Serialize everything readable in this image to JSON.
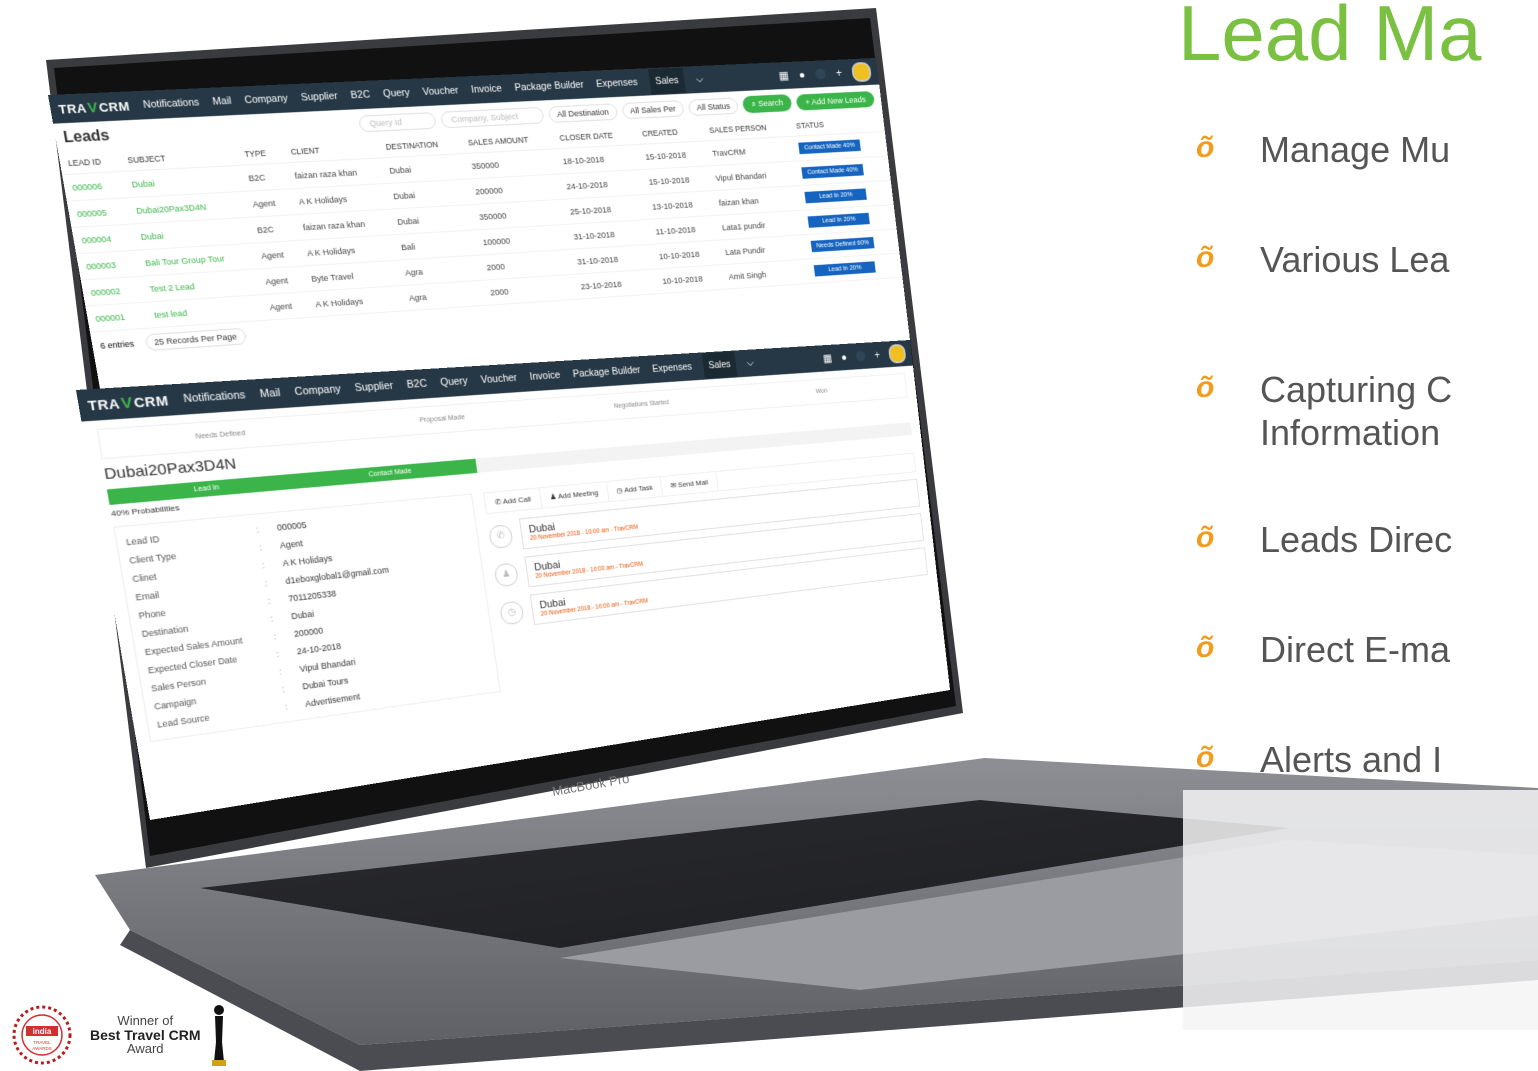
{
  "slide": {
    "title": "Lead Ma",
    "bullet_glyph": "õ",
    "bullets": [
      "Manage Mu",
      "Various Lea",
      "Capturing C",
      "Information",
      "Leads Direc",
      "Direct E-ma",
      "Alerts and I"
    ]
  },
  "award": {
    "line1": "Winner of",
    "line2": "Best Travel CRM",
    "line3": "Award",
    "seal_text": "india travel awards"
  },
  "laptop": {
    "brand_label": "MacBook Pro"
  },
  "app": {
    "logo_prefix": "TRA",
    "logo_v": "V",
    "logo_suffix": "CRM",
    "nav": [
      "Notifications",
      "Mail",
      "Company",
      "Supplier",
      "B2C",
      "Query",
      "Voucher",
      "Invoice",
      "Package Builder",
      "Expenses",
      "Sales"
    ],
    "nav_icons": [
      "calendar-icon",
      "mic-icon",
      "notification-badge",
      "plus-icon",
      "user-avatar"
    ]
  },
  "leads_page": {
    "title": "Leads",
    "filters": {
      "query_placeholder": "Query Id",
      "company_placeholder": "Company, Subject",
      "destination": "All Destination",
      "sales_person": "All Sales Per",
      "status": "All Status",
      "search": "Search",
      "add_new": "+ Add New Leads"
    },
    "columns": [
      "LEAD ID",
      "SUBJECT",
      "TYPE",
      "CLIENT",
      "DESTINATION",
      "SALES AMOUNT",
      "CLOSER DATE",
      "CREATED",
      "SALES PERSON",
      "STATUS"
    ],
    "rows": [
      [
        "000006",
        "Dubai",
        "B2C",
        "faizan raza khan",
        "Dubai",
        "350000",
        "18-10-2018",
        "15-10-2018",
        "TravCRM",
        "Contact Made 40%"
      ],
      [
        "000005",
        "Dubai20Pax3D4N",
        "Agent",
        "A K Holidays",
        "Dubai",
        "200000",
        "24-10-2018",
        "15-10-2018",
        "Vipul Bhandari",
        "Contact Made 40%"
      ],
      [
        "000004",
        "Dubai",
        "B2C",
        "faizan raza khan",
        "Dubai",
        "350000",
        "25-10-2018",
        "13-10-2018",
        "faizan khan",
        "Lead In 20%"
      ],
      [
        "000003",
        "Bali Tour Group Tour",
        "Agent",
        "A K Holidays",
        "Bali",
        "100000",
        "31-10-2018",
        "11-10-2018",
        "Lata1 pundir",
        "Lead In 20%"
      ],
      [
        "000002",
        "Test 2 Lead",
        "Agent",
        "Byte Travel",
        "Agra",
        "2000",
        "31-10-2018",
        "10-10-2018",
        "Lata Pundir",
        "Needs Defined 60%"
      ],
      [
        "000001",
        "test lead",
        "Agent",
        "A K Holidays",
        "Agra",
        "2000",
        "23-10-2018",
        "10-10-2018",
        "Amit Singh",
        "Lead In 20%"
      ]
    ],
    "entries": "6 entries",
    "per_page": "25 Records Per Page"
  },
  "lead_detail": {
    "title": "Dubai20Pax3D4N",
    "stages": [
      "Lead In",
      "Contact Made",
      "Needs Defined",
      "Proposal Made",
      "Negotiations Started",
      "Won"
    ],
    "probability": "40% Probabilities",
    "fields": [
      [
        "Lead ID",
        "000005"
      ],
      [
        "Client Type",
        "Agent"
      ],
      [
        "Clinet",
        "A K Holidays"
      ],
      [
        "Email",
        "d1eboxglobal1@gmail.com"
      ],
      [
        "Phone",
        "7011205338"
      ],
      [
        "Destination",
        "Dubai"
      ],
      [
        "Expected Sales Amount",
        "200000"
      ],
      [
        "Expected Closer Date",
        "24-10-2018"
      ],
      [
        "Sales Person",
        "Vipul Bhandari"
      ],
      [
        "Campaign",
        "Dubai Tours"
      ],
      [
        "Lead Source",
        "Advertisement"
      ]
    ],
    "actions": [
      "Add Call",
      "Add Meeting",
      "Add Task",
      "Send Mail"
    ],
    "timeline": [
      {
        "icon": "phone-icon",
        "title": "Dubai",
        "meta": "20 November 2018 - 10:00 am  -  TravCRM"
      },
      {
        "icon": "user-icon",
        "title": "Dubai",
        "meta": "20 November 2018 - 10:00 am  -  TravCRM"
      },
      {
        "icon": "clock-icon",
        "title": "Dubai",
        "meta": "20 November 2018 - 10:00 am  -  TravCRM"
      }
    ]
  },
  "colors": {
    "accent_green": "#7ac142",
    "app_green": "#3bb54a",
    "nav_dark": "#263846",
    "status_blue": "#1565c0",
    "bullet_orange": "#f29b1d"
  }
}
